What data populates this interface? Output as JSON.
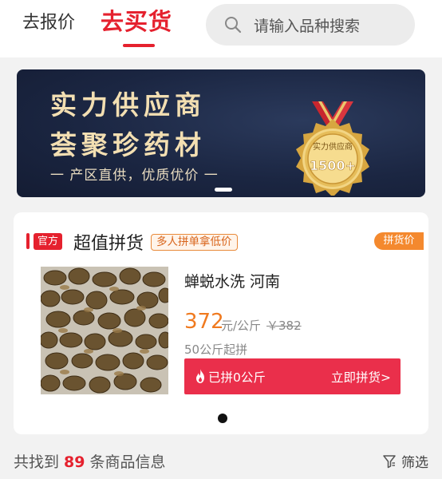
{
  "header": {
    "tab_sell": "去报价",
    "tab_buy": "去买货",
    "search_placeholder": "请输入品种搜索",
    "active_color": "#e5212e"
  },
  "banner": {
    "line1": "实力供应商",
    "line2": "荟聚珍药材",
    "subtitle": "一 产区直供，优质优价 一",
    "medal_label": "实力供应商",
    "medal_value": "1500+"
  },
  "section": {
    "official_tag": "官方",
    "title": "超值拼货",
    "promo": "多人拼单拿低价",
    "badge": "拼货价"
  },
  "product": {
    "name": "蝉蜕水洗 河南",
    "price": "372",
    "unit": "元/公斤",
    "old_price": "￥382",
    "min_order": "50公斤起拼",
    "button_left": "已拼0公斤",
    "button_right": "立即拼货>",
    "button_color": "#ea2f4b",
    "price_color": "#f07a1f"
  },
  "footer": {
    "result_prefix": "共找到",
    "result_count": "89",
    "result_suffix": "条商品信息",
    "filter_label": "筛选"
  }
}
